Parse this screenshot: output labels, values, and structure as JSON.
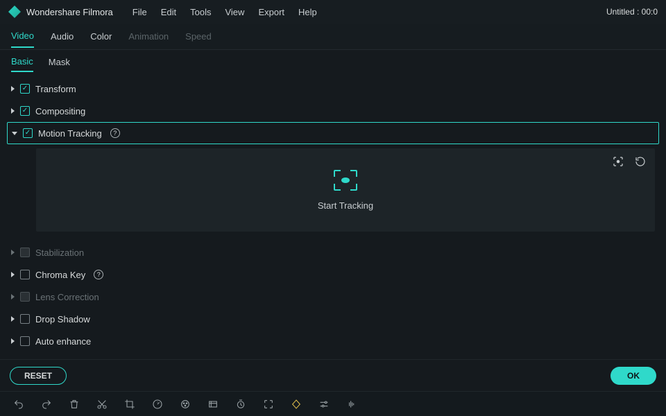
{
  "app": {
    "title": "Wondershare Filmora",
    "document": "Untitled : 00:0"
  },
  "menubar": [
    "File",
    "Edit",
    "Tools",
    "View",
    "Export",
    "Help"
  ],
  "primary_tabs": [
    {
      "label": "Video",
      "state": "active"
    },
    {
      "label": "Audio",
      "state": "normal"
    },
    {
      "label": "Color",
      "state": "normal"
    },
    {
      "label": "Animation",
      "state": "disabled"
    },
    {
      "label": "Speed",
      "state": "disabled"
    }
  ],
  "sub_tabs": [
    {
      "label": "Basic",
      "state": "active"
    },
    {
      "label": "Mask",
      "state": "normal"
    }
  ],
  "panels": [
    {
      "label": "Transform",
      "checked": true,
      "disabled": false,
      "expanded": false,
      "selected": false
    },
    {
      "label": "Compositing",
      "checked": true,
      "disabled": false,
      "expanded": false,
      "selected": false
    },
    {
      "label": "Motion Tracking",
      "checked": true,
      "disabled": false,
      "expanded": true,
      "selected": true,
      "help": true
    },
    {
      "label": "Stabilization",
      "checked": false,
      "disabled": true,
      "expanded": false,
      "selected": false
    },
    {
      "label": "Chroma Key",
      "checked": false,
      "disabled": false,
      "expanded": false,
      "selected": false,
      "help": true
    },
    {
      "label": "Lens Correction",
      "checked": false,
      "disabled": true,
      "expanded": false,
      "selected": false
    },
    {
      "label": "Drop Shadow",
      "checked": false,
      "disabled": false,
      "expanded": false,
      "selected": false
    },
    {
      "label": "Auto enhance",
      "checked": false,
      "disabled": false,
      "expanded": false,
      "selected": false
    }
  ],
  "motion_tracking": {
    "start_label": "Start Tracking"
  },
  "footer": {
    "reset": "RESET",
    "ok": "OK"
  },
  "toolbar_icons": [
    "undo",
    "redo",
    "delete",
    "cut",
    "crop",
    "speed",
    "color",
    "freeze-frame",
    "duration",
    "fit",
    "keyframe",
    "adjustments",
    "audio-waveform"
  ]
}
